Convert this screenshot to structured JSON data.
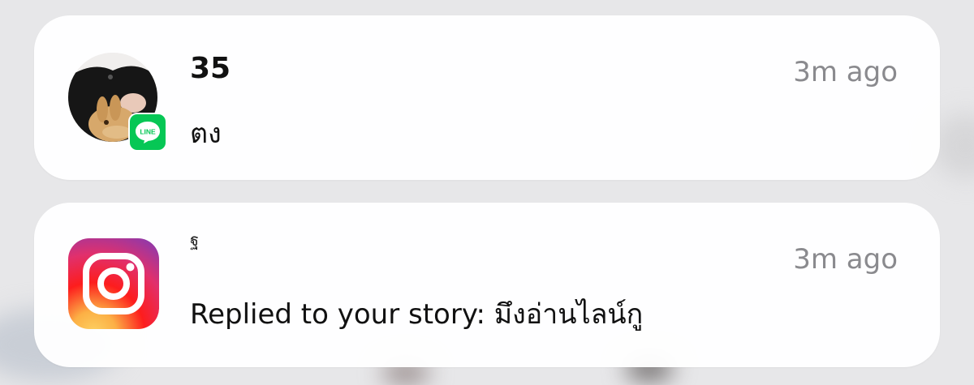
{
  "notifications": [
    {
      "app": "LINE",
      "app_badge_label": "LINE",
      "sender": "35",
      "message": "ตง",
      "time": "3m ago",
      "badge_color": "#06c755"
    },
    {
      "app": "Instagram",
      "sender": "ฐ",
      "message": "Replied to your story: มึงอ่านไลน์กู",
      "time": "3m ago"
    }
  ]
}
